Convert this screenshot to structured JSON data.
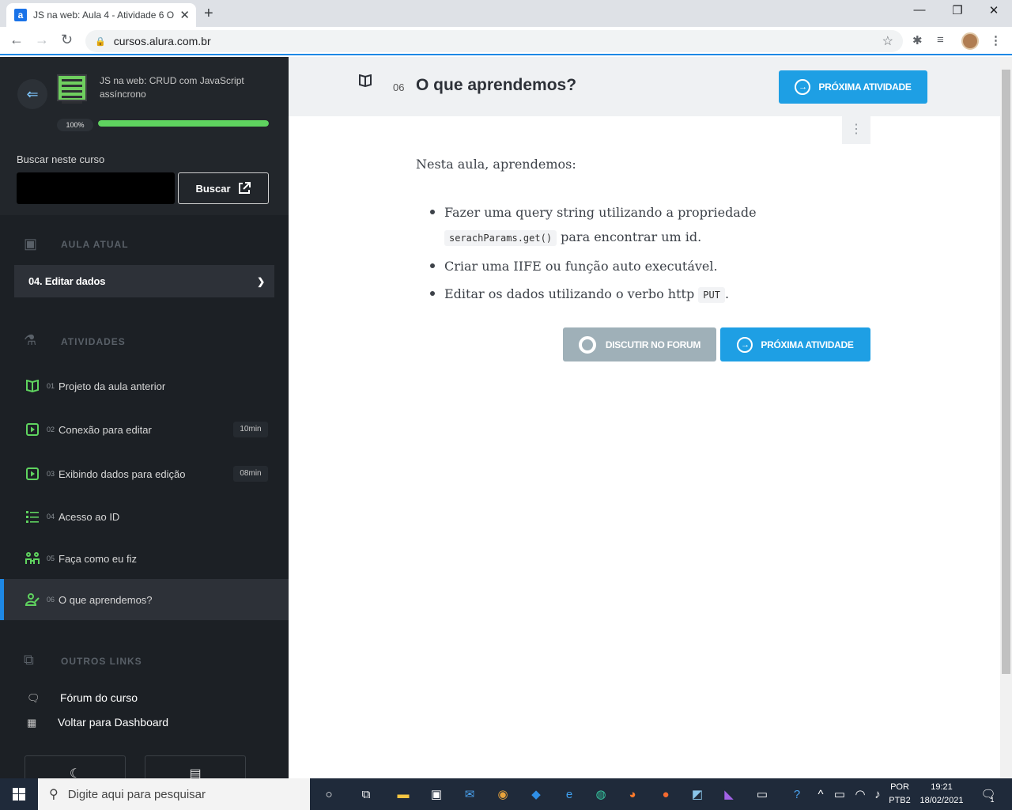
{
  "browser": {
    "tab_title": "JS na web: Aula 4 - Atividade 6 O",
    "favicon": "a",
    "url": "cursos.alura.com.br"
  },
  "sidebar": {
    "course_title": "JS na web: CRUD com JavaScript assíncrono",
    "progress_text": "100%",
    "progress_value": 1.0,
    "search_label": "Buscar neste curso",
    "search_placeholder": "",
    "search_button": "Buscar",
    "current_section_label": "AULA ATUAL",
    "current_lesson": "04. Editar dados",
    "activities_label": "ATIVIDADES",
    "activities": [
      {
        "num": "01",
        "label": "Projeto da aula anterior",
        "duration": "",
        "icon": "book-icon"
      },
      {
        "num": "02",
        "label": "Conexão para editar",
        "duration": "10min",
        "icon": "video-icon"
      },
      {
        "num": "03",
        "label": "Exibindo dados para edição",
        "duration": "08min",
        "icon": "video-icon"
      },
      {
        "num": "04",
        "label": "Acesso ao ID",
        "duration": "",
        "icon": "list-icon"
      },
      {
        "num": "05",
        "label": "Faça como eu fiz",
        "duration": "",
        "icon": "practice-icon"
      },
      {
        "num": "06",
        "label": "O que aprendemos?",
        "duration": "",
        "icon": "learned-icon"
      }
    ],
    "other_links_label": "OUTROS LINKS",
    "forum_link": "Fórum do curso",
    "dashboard_link": "Voltar para Dashboard"
  },
  "main": {
    "activity_num": "06",
    "title": "O que aprendemos?",
    "next_button": "PRÓXIMA ATIVIDADE",
    "forum_button": "DISCUTIR NO FORUM",
    "intro": "Nesta aula, aprendemos:",
    "bullet1_a": "Fazer uma query string utilizando a propriedade",
    "bullet1_code": "serachParams.get()",
    "bullet1_b": " para encontrar um id.",
    "bullet2": "Criar uma IIFE ou função auto executável.",
    "bullet3_a": "Editar os dados utilizando o verbo http ",
    "bullet3_code": "PUT",
    "bullet3_b": "."
  },
  "taskbar": {
    "search_placeholder": "Digite aqui para pesquisar",
    "lang_top": "POR",
    "lang_bottom": "PTB2",
    "time": "19:21",
    "date": "18/02/2021",
    "notif_count": "1"
  },
  "colors": {
    "accent": "#1e9fe4",
    "sidebar_bg": "#1c2025",
    "progress": "#5fd35f"
  }
}
